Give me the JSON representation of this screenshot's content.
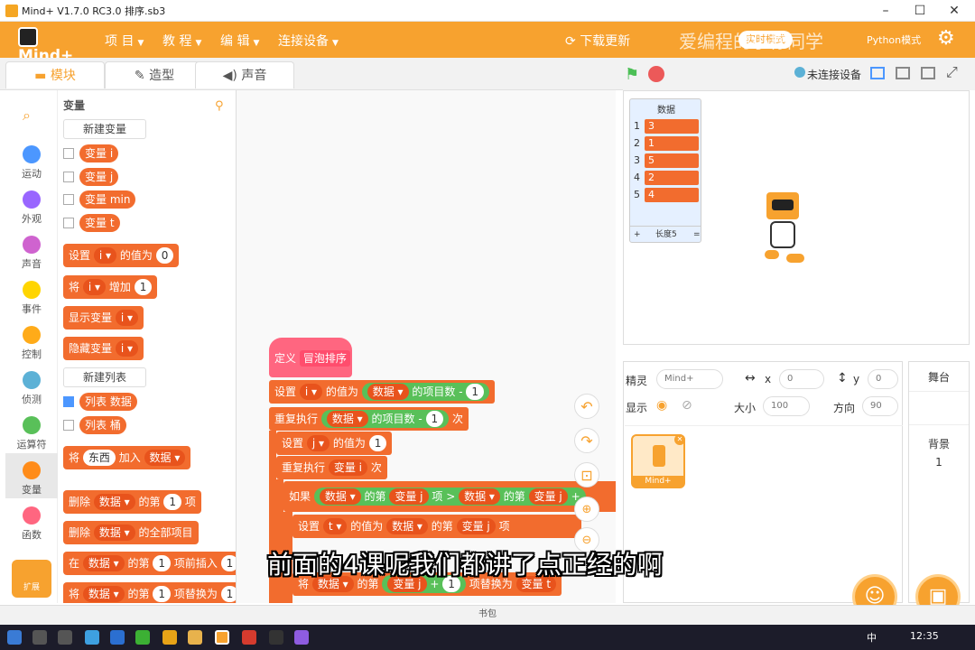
{
  "window": {
    "title": "Mind+ V1.7.0 RC3.0   排序.sb3",
    "minimize": "–",
    "maximize": "☐",
    "close": "✕"
  },
  "menubar": {
    "logo": "Mind+",
    "items": [
      "项 目",
      "教 程",
      "编 辑",
      "连接设备"
    ],
    "update": "下载更新",
    "watermark": "爱编程的小栋同学",
    "mode_badge": "实时模式",
    "python": "Python模式"
  },
  "tabs": [
    "模块",
    "造型",
    "声音"
  ],
  "stage_header": {
    "not_connected": "未连接设备"
  },
  "categories": [
    {
      "label": "运动",
      "color": "#4c97ff"
    },
    {
      "label": "外观",
      "color": "#9966ff"
    },
    {
      "label": "声音",
      "color": "#cf63cf"
    },
    {
      "label": "事件",
      "color": "#ffd500"
    },
    {
      "label": "控制",
      "color": "#ffab19"
    },
    {
      "label": "侦测",
      "color": "#5cb1d6"
    },
    {
      "label": "运算符",
      "color": "#59c059"
    },
    {
      "label": "变量",
      "color": "#ff8c1a"
    },
    {
      "label": "函数",
      "color": "#ff6680"
    }
  ],
  "extension_label": "扩展",
  "palette": {
    "heading": "变量",
    "new_var": "新建变量",
    "vars": [
      "变量 i",
      "变量 j",
      "变量 min",
      "变量 t"
    ],
    "set_prefix": "设置",
    "set_var": "i ▾",
    "set_mid": "的值为",
    "set_val": "0",
    "change_prefix": "将",
    "change_var": "i ▾",
    "change_mid": "增加",
    "change_val": "1",
    "show_var": "显示变量",
    "show_var_arg": "i ▾",
    "hide_var": "隐藏变量",
    "hide_var_arg": "i ▾",
    "new_list": "新建列表",
    "lists": [
      "列表 数据",
      "列表 桶"
    ],
    "add_prefix": "将",
    "add_item": "东西",
    "add_mid": "加入",
    "add_list": "数据 ▾",
    "del_prefix": "删除",
    "del_list": "数据 ▾",
    "del_mid": "的第",
    "del_idx": "1",
    "del_suffix": "项",
    "delall_prefix": "删除",
    "delall_list": "数据 ▾",
    "delall_suffix": "的全部项目",
    "ins_prefix": "在",
    "ins_list": "数据 ▾",
    "ins_mid": "的第",
    "ins_idx": "1",
    "ins_suffix": "项前插入",
    "ins_tail": "1",
    "rep_prefix": "将",
    "rep_list": "数据 ▾",
    "rep_mid": "的第",
    "rep_idx": "1",
    "rep_suffix": "项替换为",
    "rep_tail": "1"
  },
  "script": {
    "define": "定义",
    "define_name": "冒泡排序",
    "l1": [
      "设置",
      "i ▾",
      "的值为",
      "数据 ▾",
      "的项目数",
      "-",
      "1"
    ],
    "l2": [
      "重复执行",
      "数据 ▾",
      "的项目数",
      "-",
      "1",
      "次"
    ],
    "l3": [
      "设置",
      "j ▾",
      "的值为",
      "1"
    ],
    "l4": [
      "重复执行",
      "变量 i",
      "次"
    ],
    "l5": [
      "如果",
      "数据 ▾",
      "的第",
      "变量 j",
      "项",
      ">",
      "数据 ▾",
      "的第",
      "变量 j",
      "+"
    ],
    "l6": [
      "设置",
      "t ▾",
      "的值为",
      "数据 ▾",
      "的第",
      "变量 j",
      "项"
    ],
    "l7": [
      "将",
      "数据 ▾",
      "的第",
      "变量 j",
      "+",
      "1",
      "项替换为",
      "变量 t"
    ]
  },
  "list_monitor": {
    "title": "数据",
    "items": [
      {
        "idx": "1",
        "val": "3"
      },
      {
        "idx": "2",
        "val": "1"
      },
      {
        "idx": "3",
        "val": "5"
      },
      {
        "idx": "4",
        "val": "2"
      },
      {
        "idx": "5",
        "val": "4"
      }
    ],
    "footer_add": "+",
    "footer_len": "长度5",
    "footer_eq": "="
  },
  "sprite": {
    "label": "精灵",
    "name": "Mind+",
    "x_label": "x",
    "x": "0",
    "y_label": "y",
    "y": "0",
    "show_label": "显示",
    "size_label": "大小",
    "size": "100",
    "dir_label": "方向",
    "dir": "90",
    "thumb": "Mind+"
  },
  "stage_panel": {
    "title": "舞台",
    "backdrop": "背景",
    "count": "1"
  },
  "subtitle": "前面的4课呢我们都讲了点正经的啊",
  "statusbar": "书包",
  "taskbar": {
    "time": "12:35",
    "lang": "中"
  },
  "colors": {
    "accent": "#f7a22f",
    "block_var": "#f26c2e",
    "block_op": "#59c059"
  }
}
